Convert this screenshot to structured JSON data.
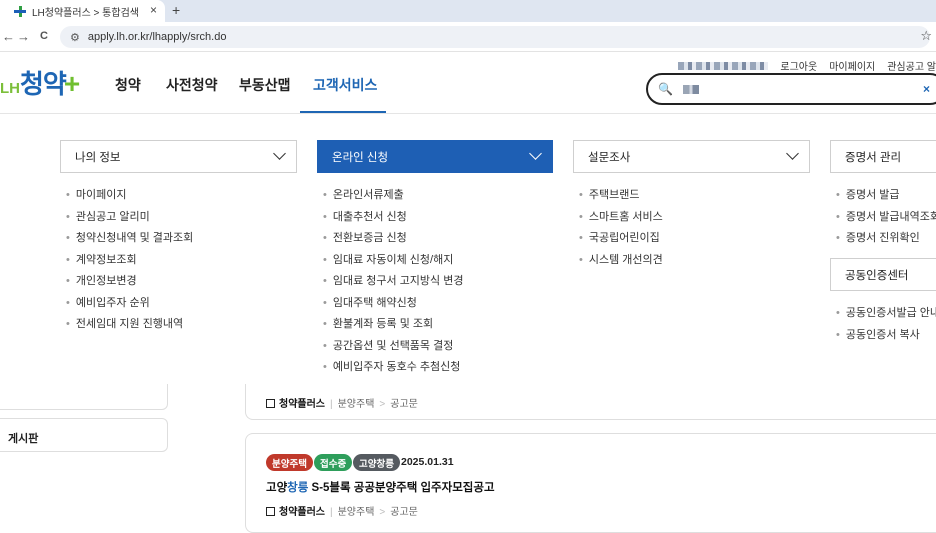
{
  "browser": {
    "tab_title": "LH청약플러스 > 통합검색",
    "tab_close": "×",
    "new_tab": "+",
    "back": "←",
    "forward": "→",
    "reload": "C",
    "url": "apply.lh.or.kr/lhapply/srch.do",
    "star": "☆"
  },
  "header": {
    "util_links": [
      "로그아웃",
      "마이페이지",
      "관심공고 알"
    ],
    "logo": {
      "prefix": "LH",
      "name": "청약",
      "suffix": "+"
    },
    "gnb": [
      "청약",
      "사전청약",
      "부동산맵",
      "고객서비스"
    ],
    "active_gnb": "고객서비스",
    "search_clear": "×"
  },
  "mega_menu": {
    "columns": [
      {
        "title": "나의 정보",
        "items": [
          "마이페이지",
          "관심공고 알리미",
          "청약신청내역 및 결과조회",
          "계약정보조회",
          "개인정보변경",
          "예비입주자 순위",
          "전세임대 지원 진행내역"
        ]
      },
      {
        "title": "온라인 신청",
        "items": [
          "온라인서류제출",
          "대출추천서 신청",
          "전환보증금 신청",
          "임대료 자동이체 신청/해지",
          "임대료 청구서 고지방식 변경",
          "임대주택 해약신청",
          "환불계좌 등록 및 조회",
          "공간옵션 및 선택품목 결정",
          "예비입주자 동호수 추첨신청"
        ]
      },
      {
        "title": "설문조사",
        "items": [
          "주택브랜드",
          "스마트홈 서비스",
          "국공립어린이집",
          "시스템 개선의견"
        ]
      },
      {
        "title": "증명서 관리",
        "items": [
          "증명서 발급",
          "증명서 발급내역조회",
          "증명서 진위확인"
        ]
      },
      {
        "title": "공동인증센터",
        "items": [
          "공동인증서발급 안내",
          "공동인증서 복사"
        ]
      }
    ]
  },
  "background": {
    "sidebar_board": "게시판",
    "card_top_crumb": {
      "brand": "청약플러스",
      "path": [
        "분양주택",
        "공고문"
      ]
    },
    "listing": {
      "badges": [
        {
          "text": "분양주택",
          "color": "#c0392b"
        },
        {
          "text": "접수중",
          "color": "#2e9e5b"
        },
        {
          "text": "고양창릉",
          "color": "#555a60"
        }
      ],
      "date": "2025.01.31",
      "title_pre": "고양",
      "title_hl": "창릉",
      "title_post": " S-5블록 공공분양주택 입주자모집공고",
      "crumb": {
        "brand": "청약플러스",
        "path": [
          "분양주택",
          "공고문"
        ]
      }
    }
  }
}
